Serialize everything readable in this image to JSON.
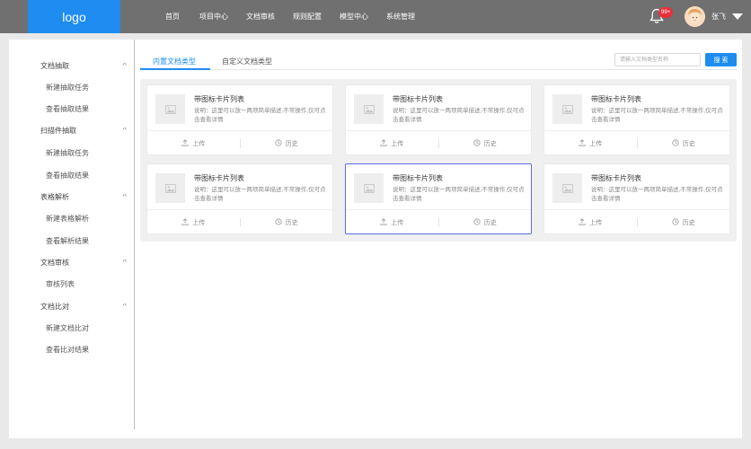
{
  "header": {
    "logo": "logo",
    "nav": [
      "首页",
      "项目中心",
      "文档审核",
      "规则配置",
      "模型中心",
      "系统管理"
    ],
    "badge": "99+",
    "username": "张飞",
    "bell_icon": "bell-icon",
    "accent": "#1e8cf0"
  },
  "sidebar": {
    "groups": [
      {
        "label": "文档抽取",
        "items": [
          "新建抽取任务",
          "查看抽取结果"
        ]
      },
      {
        "label": "扫描件抽取",
        "items": [
          "新建抽取任务",
          "查看抽取结果"
        ]
      },
      {
        "label": "表格解析",
        "items": [
          "新建表格解析",
          "查看解析结果"
        ]
      },
      {
        "label": "文档审核",
        "items": [
          "审核列表"
        ]
      },
      {
        "label": "文档比对",
        "items": [
          "新建文档比对",
          "查看比对结果"
        ]
      }
    ],
    "chevron": "^"
  },
  "tabs": [
    "内置文档类型",
    "自定义文档类型"
  ],
  "search": {
    "placeholder": "请输入文档类型名称",
    "button": "搜 索"
  },
  "cards": [
    {
      "title": "带图标卡片列表",
      "desc": "说明：这里可以放一两项简单描述,不常操作,仅可点击查看详情",
      "upload": "上传",
      "history": "历史",
      "selected": false
    },
    {
      "title": "带图标卡片列表",
      "desc": "说明：这里可以放一两项简单描述,不常操作,仅可点击查看详情",
      "upload": "上传",
      "history": "历史",
      "selected": false
    },
    {
      "title": "带图标卡片列表",
      "desc": "说明：这里可以放一两项简单描述,不常操作,仅可点击查看详情",
      "upload": "上传",
      "history": "历史",
      "selected": false
    },
    {
      "title": "带图标卡片列表",
      "desc": "说明：这里可以放一两项简单描述,不常操作,仅可点击查看详情",
      "upload": "上传",
      "history": "历史",
      "selected": false
    },
    {
      "title": "带图标卡片列表",
      "desc": "说明：这里可以放一两项简单描述,不常操作,仅可点击查看详情",
      "upload": "上传",
      "history": "历史",
      "selected": true
    },
    {
      "title": "带图标卡片列表",
      "desc": "说明：这里可以放一两项简单描述,不常操作,仅可点击查看详情",
      "upload": "上传",
      "history": "历史",
      "selected": false
    }
  ]
}
